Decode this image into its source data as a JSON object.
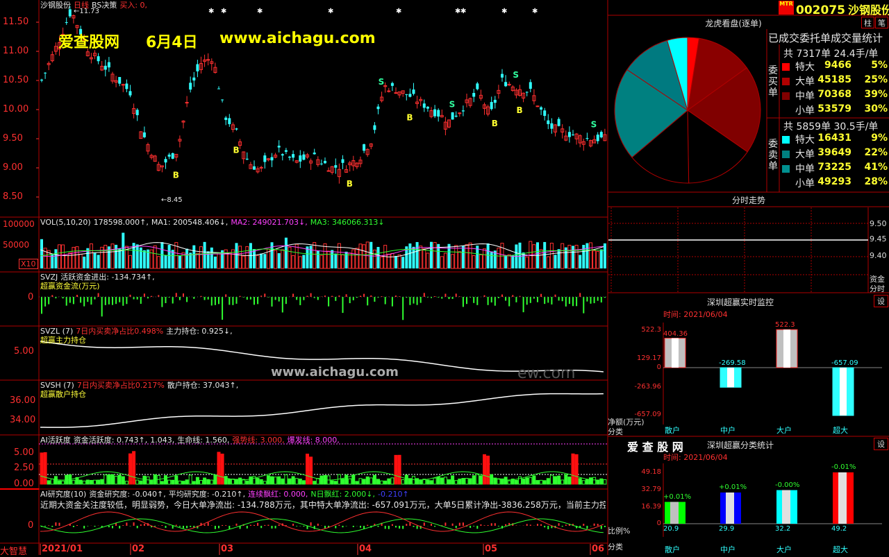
{
  "stock": {
    "code": "002075",
    "name": "沙钢股份",
    "badge": "MTR",
    "btn_zhu": "柱",
    "btn_bi": "笔"
  },
  "watermark": {
    "site": "爱查股网",
    "date": "6月4日",
    "url": "www.aichagu.com",
    "url2": "www.aichagu.com",
    "ghost": "ew.com"
  },
  "main_header": {
    "name": "沙钢股份",
    "period": "日线",
    "indicator": "BS决策",
    "buy_label": "买入: 0,"
  },
  "price_axis": [
    "11.50",
    "11.00",
    "10.50",
    "10.00",
    "9.50",
    "9.00",
    "8.50"
  ],
  "price_marks": {
    "high": "11.73",
    "low": "8.45"
  },
  "vol_header": {
    "name": "VOL(5,10,20)",
    "vol": "178598.000↑,",
    "ma1": "MA1: 200548.406↓,",
    "ma2": "MA2: 249021.703↓,",
    "ma3": "MA3: 346066.313↓"
  },
  "vol_axis": [
    "100000",
    "50000"
  ],
  "vol_mult": "X10",
  "svzj_header": {
    "name": "SVZJ",
    "desc": "活跃资金进出: -134.734↑,",
    "sub": "超赢资金流(万元)"
  },
  "svzj_axis": [
    "0"
  ],
  "svzl_header": {
    "name": "SVZL (7)",
    "desc": "7日内买卖净占比0.498%",
    "extra": "主力持仓: 0.925↓,",
    "sub": "超赢主力持仓"
  },
  "svzl_axis": [
    "5.00"
  ],
  "svsh_header": {
    "name": "SVSH (7)",
    "desc": "7日内买卖净占比0.217%",
    "extra": "散户持仓: 37.043↑,",
    "sub": "超赢散户持仓"
  },
  "svsh_axis": [
    "36.00",
    "34.00"
  ],
  "ai_header": {
    "name": "AI活跃度",
    "a": "资金活跃度: 0.743↑,",
    "b": "1.043,",
    "c": "生命线: 1.560,",
    "d": "强势线: 3.000,",
    "e": "爆发线: 8.000,"
  },
  "ai_axis": [
    "5.00",
    "2.50",
    "0.00"
  ],
  "air_header": {
    "name": "AI研究度(10)",
    "a": "资金研究度: -0.040↑,",
    "b": "平均研究度: -0.210↑,",
    "c": "连续飘红: 0.000,",
    "d": "N日飘红: 2.000↓,",
    "e": "-0.210↑"
  },
  "air_text": "近期大资金关注度较低，明显弱势，今日大单净流出: -134.788万元，其中特大单净流出: -657.091万元，大单5日累计净出-3836.258万元，当前主力控盘较",
  "air_axis": [
    "0"
  ],
  "date_axis": {
    "brand": "大智慧",
    "labels": [
      "2021/01",
      "02",
      "03",
      "04",
      "05",
      "06"
    ]
  },
  "dragon": {
    "title": "龙虎看盘(逐单)",
    "subtitle": "已成交委托单成交量统计",
    "buy_total": "共 7317单 24.4手/单",
    "sell_total": "共 5859单 30.5手/单",
    "buy_label": "委买单",
    "sell_label": "委卖单",
    "buy_rows": [
      {
        "name": "特大",
        "value": "9466",
        "pct": "5%",
        "color": "#ff0000"
      },
      {
        "name": "大单",
        "value": "45185",
        "pct": "25%",
        "color": "#b00000"
      },
      {
        "name": "中单",
        "value": "70368",
        "pct": "39%",
        "color": "#800000"
      },
      {
        "name": "小单",
        "value": "53579",
        "pct": "30%",
        "color": "#000000"
      }
    ],
    "sell_rows": [
      {
        "name": "特大",
        "value": "16431",
        "pct": "9%",
        "color": "#00ffff"
      },
      {
        "name": "大单",
        "value": "39649",
        "pct": "22%",
        "color": "#008080"
      },
      {
        "name": "中单",
        "value": "73225",
        "pct": "41%",
        "color": "#009090"
      },
      {
        "name": "小单",
        "value": "49293",
        "pct": "28%",
        "color": "#000000"
      }
    ]
  },
  "intraday": {
    "title": "分时走势",
    "axis": [
      "9.50",
      "9.45",
      "9.40"
    ],
    "label": "分时",
    "label2": "资金"
  },
  "monitor": {
    "title": "深圳超赢实时监控",
    "btn": "设",
    "time": "时间: 2021/06/04",
    "axis": [
      "522.3",
      "129.17",
      "0",
      "-263.96",
      "-657.09"
    ],
    "ylabel": "净额(万元)",
    "xlabel": "分类",
    "categories": [
      "散户",
      "中户",
      "大户",
      "超大"
    ],
    "values": [
      404.36,
      -269.58,
      522.3,
      -657.09
    ],
    "value_labels": [
      "404.36",
      "-269.58",
      "522.3",
      "-657.09"
    ]
  },
  "classify": {
    "title": "深圳超赢分类统计",
    "brand": "爱 查 股 网",
    "btn": "设",
    "time": "时间: 2021/06/04",
    "axis": [
      "49.18",
      "32.79",
      "16.39",
      "0"
    ],
    "ylabel": "比例%",
    "xlabel": "分类",
    "categories": [
      "散户",
      "中户",
      "大户",
      "超大"
    ],
    "values": [
      20.9,
      29.9,
      32.2,
      49.2
    ],
    "changes": [
      "+0.01%",
      "+0.01%",
      "-0.00%",
      "-0.01%"
    ],
    "colors": [
      "#00ff00",
      "#0000ff",
      "#00ffff",
      "#ff0000"
    ]
  }
}
